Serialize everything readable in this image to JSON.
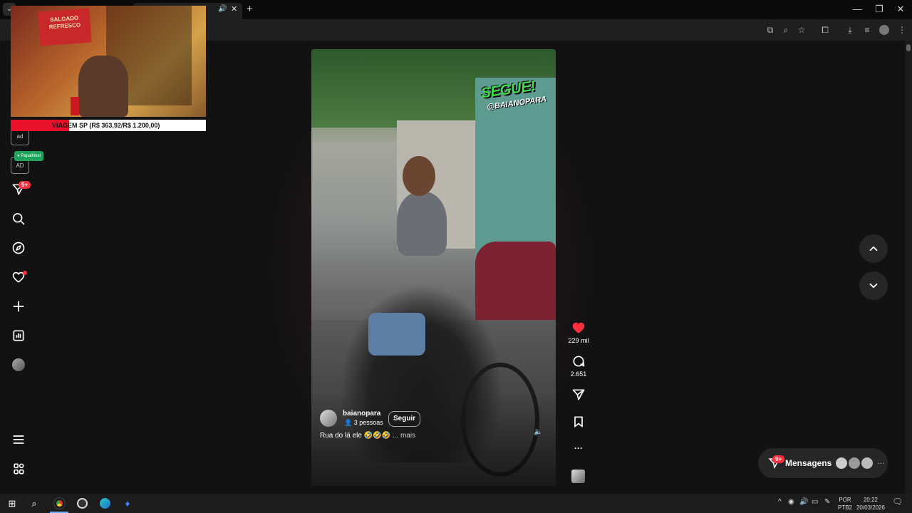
{
  "browser": {
    "tab_audio_icon": "speaker-icon",
    "window_controls": [
      "—",
      "❐",
      "✕"
    ]
  },
  "webcam_overlay": {
    "ticker_text": "VIAGEM SP (R$ 363,92/R$ 1.200,00)",
    "sign_text": "SALGADO REFRESCO",
    "tag_label": "PapaiNoel"
  },
  "nav": {
    "notifications_badge": "9+",
    "ad_labels": [
      "ad",
      "AD"
    ]
  },
  "reel": {
    "overlay_title": "SEGUE!",
    "overlay_handle": "@BAIANOPARA",
    "username": "baianopara",
    "audience": "3 pessoas",
    "follow_label": "Seguir",
    "caption": "Rua do lá ele 🤣🤣🤣",
    "more_label": "... mais"
  },
  "actions": {
    "likes": "229 mil",
    "comments": "2.651",
    "more": "···",
    "like_color": "#ff3040"
  },
  "messages": {
    "label": "Mensagens",
    "badge": "9+",
    "more": "···"
  },
  "taskbar": {
    "lang_top": "POR",
    "lang_bottom": "PTB2",
    "time": "20:22",
    "date": "20/03/2026"
  }
}
